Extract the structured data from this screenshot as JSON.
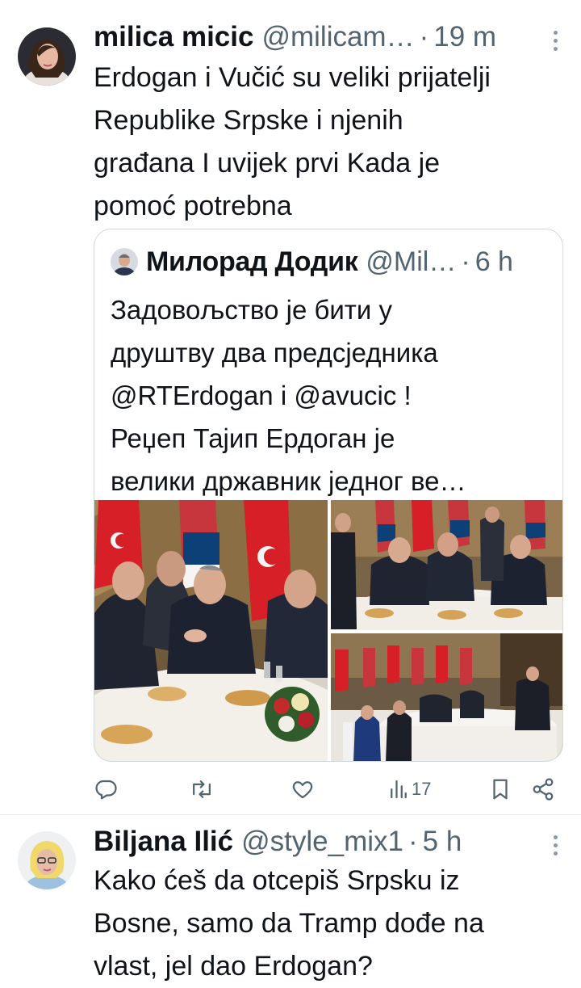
{
  "tweets": [
    {
      "name": "milica micic",
      "handle": "@milicam…",
      "time": "19 m",
      "text_lines": [
        "Erdogan i Vučić su veliki prijatelji",
        "Republike Srpske i njenih",
        "građana I uvijek prvi Kada je",
        "pomoć potrebna"
      ]
    },
    {
      "name": "Biljana Ilić",
      "handle": "@style_mix1",
      "time": "5 h",
      "text_lines": [
        "Kako ćeš da otcepiš Srpsku iz",
        "Bosne, samo da Tramp dođe na",
        "vlast, jel dao Erdogan?"
      ]
    }
  ],
  "quote": {
    "name": "Милорад Додик",
    "handle": "@Mil…",
    "time": "6 h",
    "text_lines": [
      "Задовољство је бити у",
      "друштву два предсједника",
      "@RTErdogan і @avucic !",
      "Реџеп Тајип Ердоган је",
      "велики државник једног ве…"
    ]
  },
  "actions": {
    "reply_icon": "reply-icon",
    "retweet_icon": "retweet-icon",
    "like_icon": "like-icon",
    "views_icon": "views-icon",
    "views_count": "17",
    "bookmark_icon": "bookmark-icon",
    "share_icon": "share-icon"
  },
  "colors": {
    "text": "#0f1419",
    "secondary": "#536471",
    "border": "#cfd9de",
    "icon": "#536471"
  }
}
